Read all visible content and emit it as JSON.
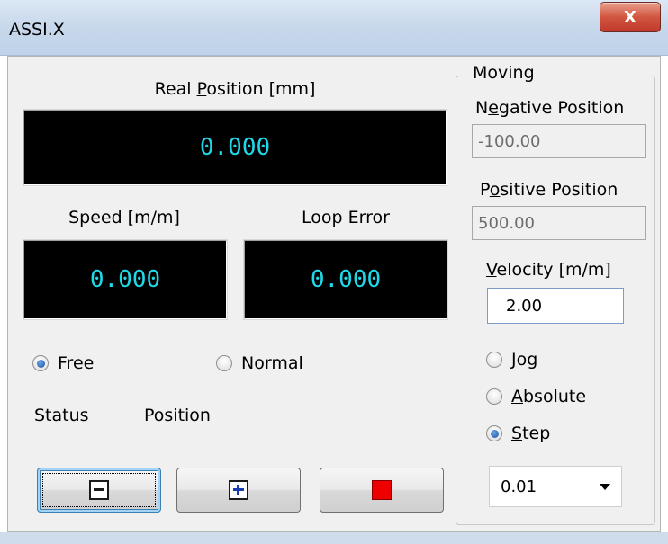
{
  "window": {
    "title": "ASSI.X",
    "close_glyph": "X"
  },
  "axis": {
    "real_position": {
      "label_pre": "Real ",
      "label_u": "P",
      "label_post": "osition [mm]",
      "value": "0.000"
    },
    "speed": {
      "label": "Speed [m/m]",
      "value": "0.000"
    },
    "loop_error": {
      "label": "Loop Error",
      "value": "0.000"
    },
    "display_color": "#1fd8e8"
  },
  "mode": {
    "free": {
      "label_u": "F",
      "label_post": "ree",
      "checked": true
    },
    "normal": {
      "label_u": "N",
      "label_post": "ormal",
      "checked": false
    }
  },
  "status": {
    "label": "Status",
    "value": "Position"
  },
  "buttons": {
    "minus": {
      "icon": "minus-box-icon"
    },
    "plus": {
      "icon": "plus-box-icon"
    },
    "stop": {
      "icon": "stop-square-icon",
      "color": "#ee0000"
    }
  },
  "moving": {
    "group_title": "Moving",
    "negative_position": {
      "label_pre": "N",
      "label_u": "e",
      "label_post": "gative Position",
      "value": "-100.00"
    },
    "positive_position": {
      "label_pre": "P",
      "label_u": "o",
      "label_post": "sitive Position",
      "value": "500.00"
    },
    "velocity": {
      "label_u": "V",
      "label_post": "elocity [m/m]",
      "value": "2.00"
    },
    "jog": {
      "label_u": "J",
      "label_post": "og",
      "checked": false
    },
    "absolute": {
      "label_u": "A",
      "label_post": "bsolute",
      "checked": false
    },
    "step": {
      "label_u": "S",
      "label_post": "tep",
      "checked": true
    },
    "step_size": "0.01"
  }
}
